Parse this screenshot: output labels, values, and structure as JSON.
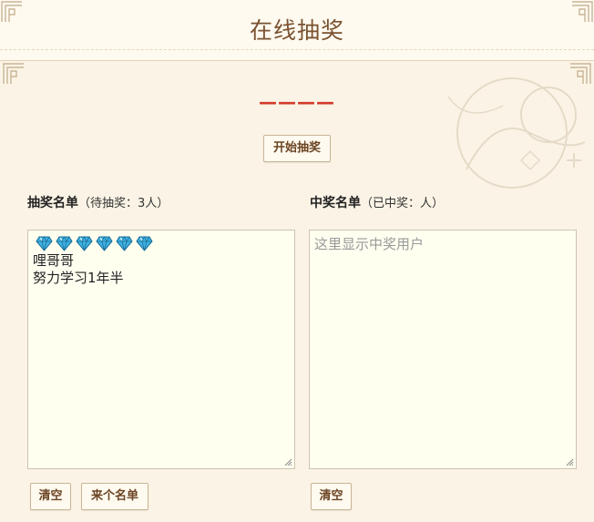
{
  "header": {
    "title": "在线抽奖"
  },
  "result": {
    "text": "————"
  },
  "buttons": {
    "start": "开始抽奖",
    "clear_left": "清空",
    "fetch_list": "来个名单",
    "clear_right": "清空"
  },
  "left_panel": {
    "label": "抽奖名单",
    "status": "（待抽奖：3人）",
    "entries": [
      "哩哥哥",
      "努力学习1年半"
    ],
    "gem_icon": "diamond-icon",
    "gem_count": 6
  },
  "right_panel": {
    "label": "中奖名单",
    "status": "（已中奖：人）",
    "placeholder": "这里显示中奖用户"
  },
  "colors": {
    "background": "#fbf4e6",
    "title": "#7a5230",
    "result": "#d23a2a",
    "gem": "#3fb3e3"
  }
}
